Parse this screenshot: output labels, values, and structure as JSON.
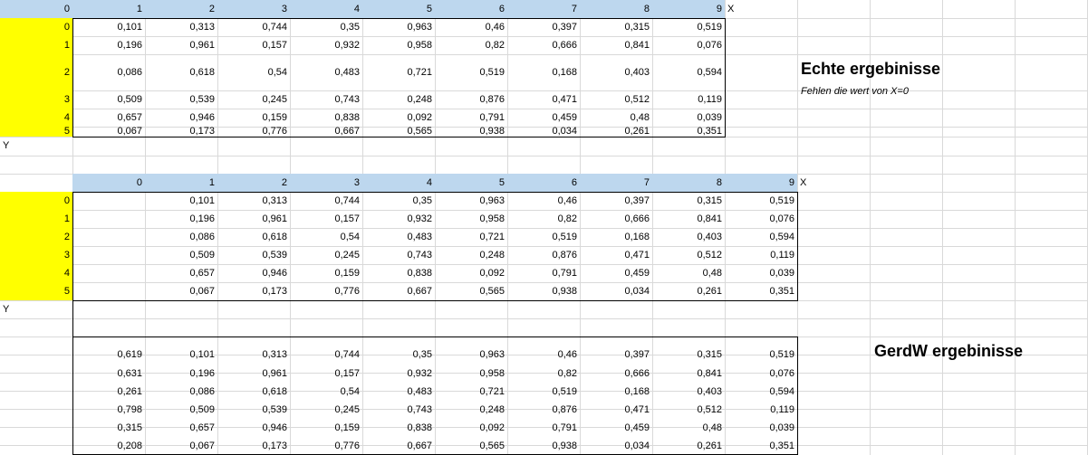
{
  "table1": {
    "header": [
      "0",
      "1",
      "2",
      "3",
      "4",
      "5",
      "6",
      "7",
      "8",
      "9"
    ],
    "x_axis_label": "X",
    "y_axis_label": "Y",
    "row_labels": [
      "0",
      "1",
      "2",
      "3",
      "4",
      "5"
    ],
    "rows": [
      [
        "0,101",
        "0,313",
        "0,744",
        "0,35",
        "0,963",
        "0,46",
        "0,397",
        "0,315",
        "0,519"
      ],
      [
        "0,196",
        "0,961",
        "0,157",
        "0,932",
        "0,958",
        "0,82",
        "0,666",
        "0,841",
        "0,076"
      ],
      [
        "0,086",
        "0,618",
        "0,54",
        "0,483",
        "0,721",
        "0,519",
        "0,168",
        "0,403",
        "0,594"
      ],
      [
        "0,509",
        "0,539",
        "0,245",
        "0,743",
        "0,248",
        "0,876",
        "0,471",
        "0,512",
        "0,119"
      ],
      [
        "0,657",
        "0,946",
        "0,159",
        "0,838",
        "0,092",
        "0,791",
        "0,459",
        "0,48",
        "0,039"
      ],
      [
        "0,067",
        "0,173",
        "0,776",
        "0,667",
        "0,565",
        "0,938",
        "0,034",
        "0,261",
        "0,351"
      ]
    ],
    "title": "Echte ergebinisse",
    "note": "Fehlen die wert von X=0"
  },
  "table2": {
    "header": [
      "0",
      "1",
      "2",
      "3",
      "4",
      "5",
      "6",
      "7",
      "8",
      "9"
    ],
    "x_axis_label": "X",
    "y_axis_label": "Y",
    "row_labels": [
      "0",
      "1",
      "2",
      "3",
      "4",
      "5"
    ],
    "rows": [
      [
        "",
        "0,101",
        "0,313",
        "0,744",
        "0,35",
        "0,963",
        "0,46",
        "0,397",
        "0,315",
        "0,519"
      ],
      [
        "",
        "0,196",
        "0,961",
        "0,157",
        "0,932",
        "0,958",
        "0,82",
        "0,666",
        "0,841",
        "0,076"
      ],
      [
        "",
        "0,086",
        "0,618",
        "0,54",
        "0,483",
        "0,721",
        "0,519",
        "0,168",
        "0,403",
        "0,594"
      ],
      [
        "",
        "0,509",
        "0,539",
        "0,245",
        "0,743",
        "0,248",
        "0,876",
        "0,471",
        "0,512",
        "0,119"
      ],
      [
        "",
        "0,657",
        "0,946",
        "0,159",
        "0,838",
        "0,092",
        "0,791",
        "0,459",
        "0,48",
        "0,039"
      ],
      [
        "",
        "0,067",
        "0,173",
        "0,776",
        "0,667",
        "0,565",
        "0,938",
        "0,034",
        "0,261",
        "0,351"
      ]
    ]
  },
  "table3": {
    "title": "GerdW ergebinisse",
    "rows": [
      [
        "0,619",
        "0,101",
        "0,313",
        "0,744",
        "0,35",
        "0,963",
        "0,46",
        "0,397",
        "0,315",
        "0,519"
      ],
      [
        "0,631",
        "0,196",
        "0,961",
        "0,157",
        "0,932",
        "0,958",
        "0,82",
        "0,666",
        "0,841",
        "0,076"
      ],
      [
        "0,261",
        "0,086",
        "0,618",
        "0,54",
        "0,483",
        "0,721",
        "0,519",
        "0,168",
        "0,403",
        "0,594"
      ],
      [
        "0,798",
        "0,509",
        "0,539",
        "0,245",
        "0,743",
        "0,248",
        "0,876",
        "0,471",
        "0,512",
        "0,119"
      ],
      [
        "0,315",
        "0,657",
        "0,946",
        "0,159",
        "0,838",
        "0,092",
        "0,791",
        "0,459",
        "0,48",
        "0,039"
      ],
      [
        "0,208",
        "0,067",
        "0,173",
        "0,776",
        "0,667",
        "0,565",
        "0,938",
        "0,034",
        "0,261",
        "0,351"
      ]
    ]
  },
  "colors": {
    "header_fill": "#bdd7ee",
    "row_label_fill": "#ffff00",
    "gridline": "#d9d9d9",
    "border": "#000000"
  }
}
